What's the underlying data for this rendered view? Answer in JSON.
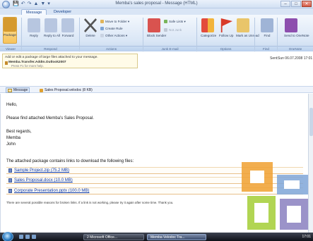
{
  "window": {
    "title": "Memba's sales proposal - Message (HTML)",
    "qat": [
      "💾",
      "↶",
      "↷",
      "▲",
      "▼",
      "▾"
    ],
    "controls": [
      "–",
      "□",
      "✕"
    ]
  },
  "tabs": [
    {
      "label": "Message",
      "active": true
    },
    {
      "label": "Developer",
      "active": false
    }
  ],
  "ribbon": {
    "buttons": [
      {
        "label": "Package",
        "icon": "package-icon",
        "color": "#d59a2f",
        "active": true
      },
      {
        "label": "Reply",
        "icon": "reply-icon",
        "color": "#b7c6e0"
      },
      {
        "label": "Reply to All",
        "icon": "reply-all-icon",
        "color": "#b7c6e0"
      },
      {
        "label": "Forward",
        "icon": "forward-icon",
        "color": "#b7c6e0"
      },
      {
        "label": "Delete",
        "icon": "delete-icon",
        "color": "#555555"
      },
      {
        "label": "Block Sender",
        "icon": "block-sender-icon",
        "color": "#d9534f"
      },
      {
        "label": "Categorize",
        "icon": "categorize-icon",
        "color": "#e3a23b"
      },
      {
        "label": "Follow Up",
        "icon": "follow-up-icon",
        "color": "#d83b2a"
      },
      {
        "label": "Mark as Unread",
        "icon": "mark-unread-icon",
        "color": "#e9c56a"
      },
      {
        "label": "Find",
        "icon": "find-icon",
        "color": "#9fb4d6"
      },
      {
        "label": "Send to OneNote",
        "icon": "onenote-icon",
        "color": "#8d4fae"
      }
    ],
    "small": {
      "move_to_folder": "Move to Folder ▾",
      "create_rule": "Create Rule",
      "other_actions": "Other Actions ▾",
      "safe_lists": "Safe Lists ▾",
      "not_junk": "Not Junk"
    },
    "groups": [
      "Viewer",
      "Respond",
      "Actions",
      "Junk E-mail",
      "Options",
      "Find",
      "OneNote"
    ]
  },
  "infobar": {
    "line1": "Add or edit a package of large files attached to your message.",
    "line2": "Memba.Transfer.AddIn.Outlook2007",
    "line3": "Press F1 for more help."
  },
  "sent": {
    "label": "Sent:",
    "value": "Sun 06.07.2008 17:01"
  },
  "attachments": [
    {
      "label": "Message",
      "icon": "envelope-icon",
      "selected": true
    },
    {
      "label": "Sales Proposal.velodoc (8 KB)",
      "icon": "package-icon",
      "selected": false
    }
  ],
  "body": {
    "greeting": "Hello,",
    "line1": "Please find attached Memba's Sales Proposal.",
    "regards": "Best regards,",
    "company": "Memba",
    "name": "John",
    "intro": "The attached package contains links to download the following files:",
    "links": [
      "Sample Project.zip (75.2 MB)",
      "Sales Proposal.docx (10.0 MB)",
      "Corporate Presentation.pptx (100.0 MB)"
    ],
    "footnote": "There are several possible reasons for broken links. If a link is not working, please try it again after some time. Thank you."
  },
  "taskbar": {
    "tasks": [
      {
        "label": "2 Microsoft Office...",
        "active": false
      },
      {
        "label": "Memba Velodoc Tra...",
        "active": true
      }
    ],
    "tray": "17:01"
  },
  "colors": {
    "logo_orange": "#f0a030",
    "logo_blue": "#7fa6d8",
    "logo_green": "#a8d040",
    "logo_purple": "#8a80c0"
  }
}
